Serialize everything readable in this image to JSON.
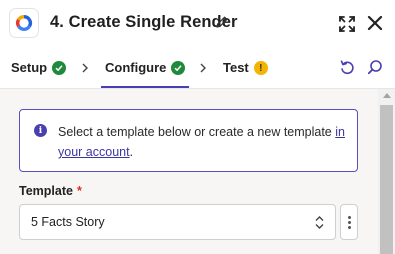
{
  "header": {
    "title": "4. Create Single Render",
    "icons": [
      "app-logo-icon",
      "pencil-icon",
      "expand-icon",
      "close-icon"
    ]
  },
  "tabs": [
    {
      "label": "Setup",
      "status": "complete"
    },
    {
      "label": "Configure",
      "status": "complete",
      "active": true
    },
    {
      "label": "Test",
      "status": "warning",
      "status_glyph": "!"
    }
  ],
  "toolbar_icons": [
    "undo-icon",
    "search-icon"
  ],
  "info": {
    "text": "Select a template below or create a new template",
    "link_text": "in your account",
    "suffix": "."
  },
  "field": {
    "label": "Template",
    "required_mark": "*",
    "value": "5 Facts Story"
  },
  "colors": {
    "accent": "#4a3fb1",
    "success": "#1f8a3b",
    "warning": "#f4b400",
    "required": "#d93025"
  }
}
